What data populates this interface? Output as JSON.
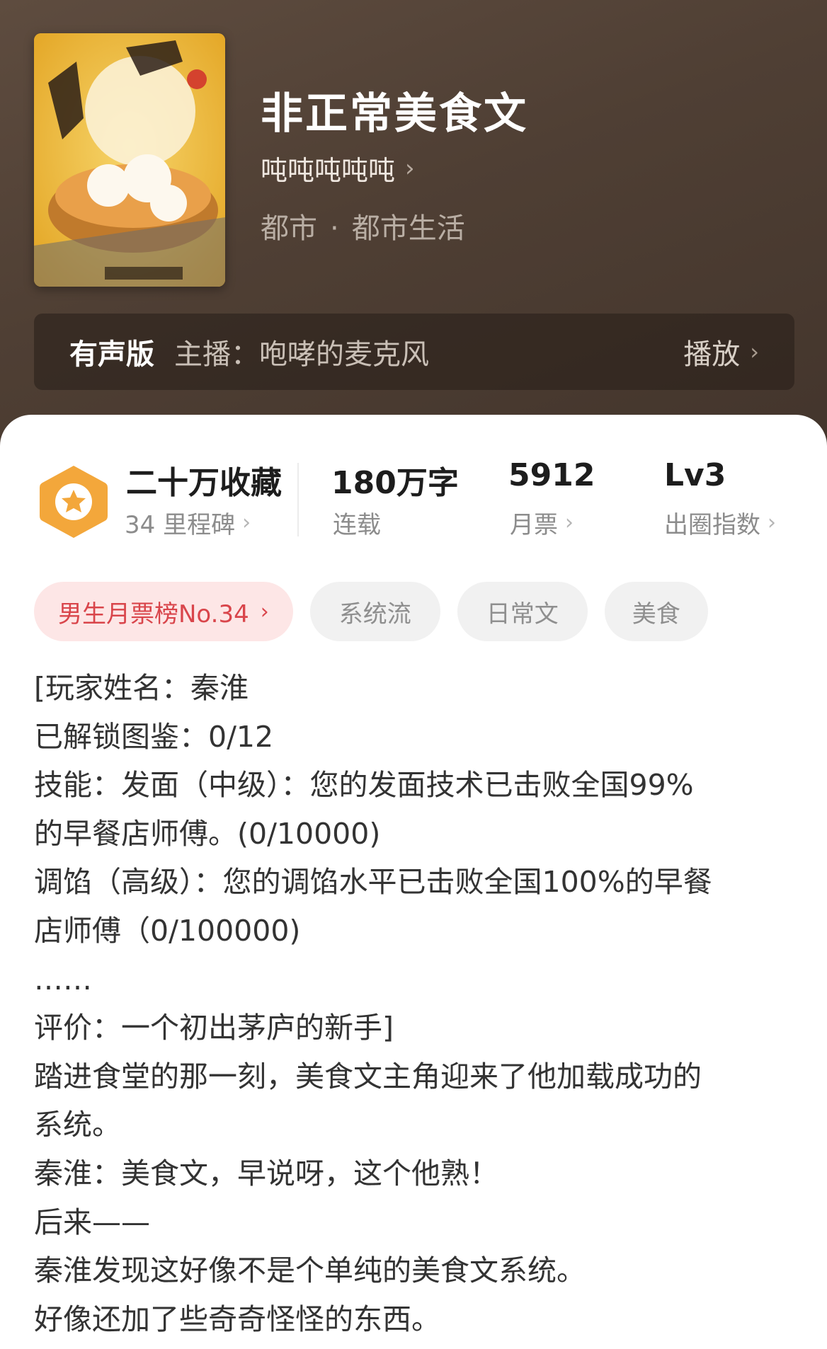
{
  "book": {
    "title": "非正常美食文",
    "author": "吨吨吨吨吨",
    "category": "都市",
    "subcategory": "都市生活",
    "separator": "·"
  },
  "audio": {
    "badge": "有声版",
    "host": "主播：咆哮的麦克风",
    "play_label": "播放"
  },
  "stats": {
    "favorites": "二十万收藏",
    "milestones": "34 里程碑",
    "word_count": "180万字",
    "status": "连载",
    "monthly_votes": "5912",
    "monthly_votes_label": "月票",
    "circle_level": "Lv3",
    "circle_label": "出圈指数"
  },
  "tags": {
    "rank": "男生月票榜No.34",
    "items": [
      "系统流",
      "日常文",
      "美食"
    ]
  },
  "synopsis": [
    " [玩家姓名：秦淮",
    "已解锁图鉴：0/12",
    "技能：发面（中级）：您的发面技术已击败全国99%",
    "的早餐店师傅。(0/10000)",
    "调馅（高级）：您的调馅水平已击败全国100%的早餐",
    "店师傅（0/100000)",
    "……",
    "评价：一个初出茅庐的新手]",
    "踏进食堂的那一刻，美食文主角迎来了他加载成功的",
    "系统。",
    "秦淮：美食文，早说呀，这个他熟！",
    "后来——",
    "秦淮发现这好像不是个单纯的美食文系统。",
    "好像还加了些奇奇怪怪的东西。"
  ],
  "icons": {
    "author_chevron": "chevron-right-icon",
    "play_chevron": "chevron-right-icon",
    "badge": "hexagon-star-icon"
  },
  "colors": {
    "hero_bg": "#4f3f34",
    "badge_orange": "#f3a73b",
    "rank_red": "#d9454b",
    "rank_bg": "#fde6e6"
  }
}
